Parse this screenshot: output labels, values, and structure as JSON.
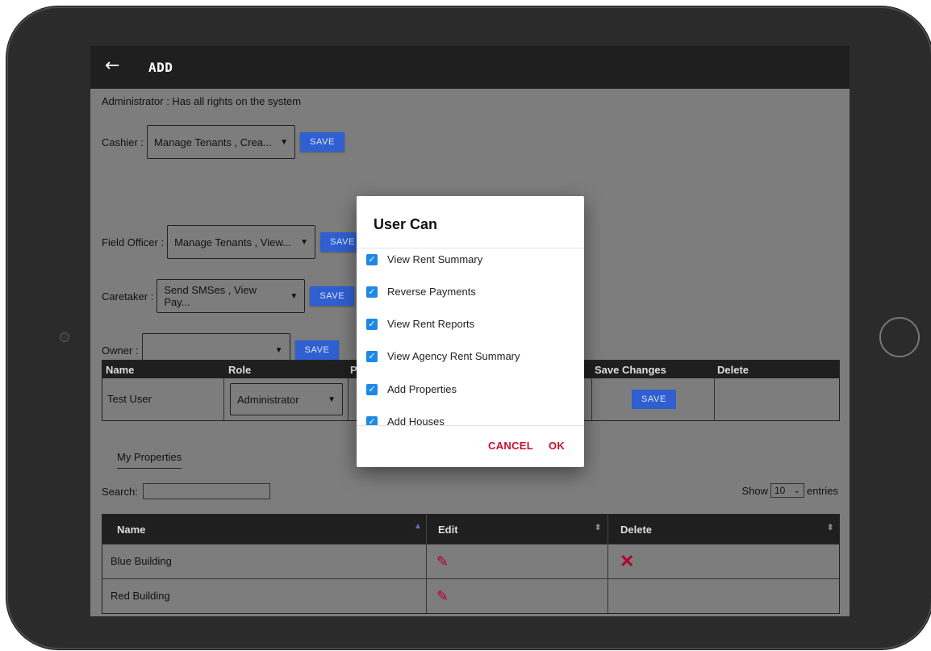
{
  "appbar": {
    "back_icon": "arrow-left-icon",
    "title": "ADD"
  },
  "admin_note": "Administrator : Has all rights on the system",
  "roles": [
    {
      "label": "Cashier :",
      "value": "Manage Tenants , Crea...",
      "save": "SAVE"
    },
    {
      "label": "Field Officer :",
      "value": "Manage Tenants , View...",
      "save": "SAVE"
    },
    {
      "label": "Caretaker :",
      "value": "Send SMSes , View Pay...",
      "save": "SAVE"
    },
    {
      "label": "Owner :",
      "value": "",
      "save": "SAVE"
    }
  ],
  "users_table": {
    "headers": [
      "Name",
      "Role",
      "P",
      "Save Changes",
      "Delete"
    ],
    "rows": [
      {
        "name": "Test User",
        "role": "Administrator",
        "save": "SAVE"
      }
    ]
  },
  "tabs": {
    "my_properties": "My Properties"
  },
  "search": {
    "label": "Search:"
  },
  "show_entries": {
    "show": "Show",
    "value": "10",
    "entries": "entries"
  },
  "properties_table": {
    "headers": [
      "Name",
      "Edit",
      "Delete"
    ],
    "rows": [
      {
        "name": "Blue Building",
        "edit_icon": "pencil-icon",
        "delete_icon": "close-icon"
      },
      {
        "name": "Red Building",
        "edit_icon": "pencil-icon"
      }
    ]
  },
  "dialog": {
    "title": "User Can",
    "options": [
      {
        "label": "View Rent Summary",
        "checked": true
      },
      {
        "label": "Reverse Payments",
        "checked": true
      },
      {
        "label": "View Rent Reports",
        "checked": true
      },
      {
        "label": "View Agency Rent Summary",
        "checked": true
      },
      {
        "label": "Add Properties",
        "checked": true
      },
      {
        "label": "Add Houses",
        "checked": true
      }
    ],
    "cancel": "CANCEL",
    "ok": "OK"
  },
  "colors": {
    "accent_blue": "#2f5fd0",
    "checkbox_blue": "#1e88e5",
    "danger_red": "#c8102e",
    "overlay": "#7d7d7d"
  }
}
